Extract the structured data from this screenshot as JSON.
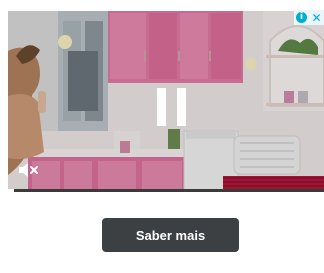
{
  "ad": {
    "cta_label": "Saber mais",
    "adchoices_info_glyph": "i",
    "adchoices_close_glyph": "✕"
  },
  "video": {
    "state": "playing",
    "muted": true,
    "progress": 0.02,
    "icons": {
      "pause": "pause-icon",
      "mute": "speaker-muted-icon",
      "adchoices": "info-icon",
      "close": "close-icon"
    }
  },
  "colors": {
    "cta_background": "#3c4043",
    "cta_text": "#ffffff",
    "adchoices_accent": "#00aecd",
    "kitchen_pink": "#e47aa6"
  }
}
